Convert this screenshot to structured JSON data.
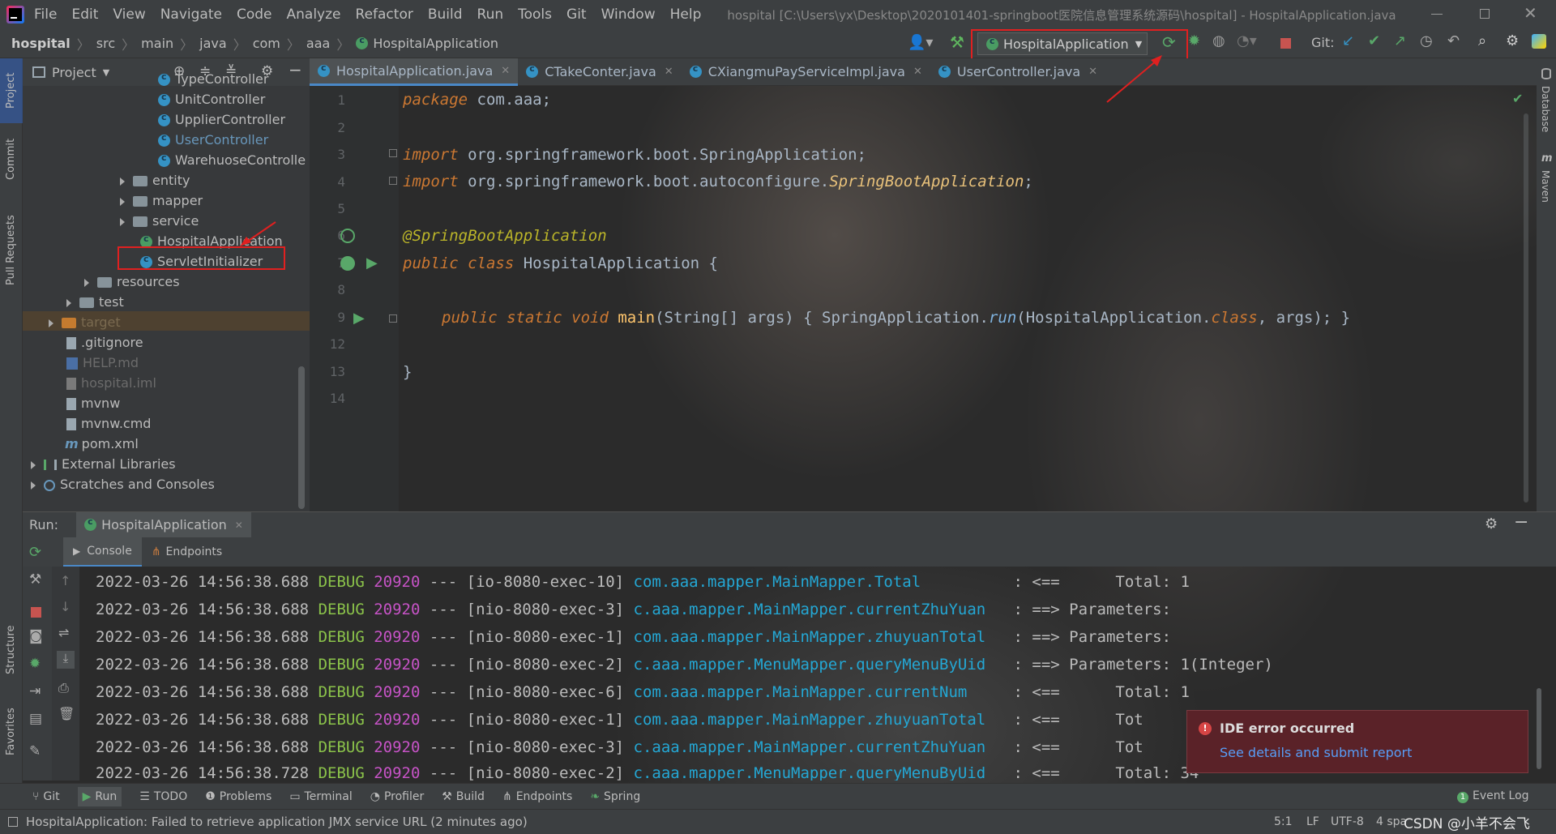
{
  "menubar": {
    "items": [
      "File",
      "Edit",
      "View",
      "Navigate",
      "Code",
      "Analyze",
      "Refactor",
      "Build",
      "Run",
      "Tools",
      "Git",
      "Window",
      "Help"
    ],
    "window_title": "hospital [C:\\Users\\yx\\Desktop\\2020101401-springboot医院信息管理系统源码\\hospital] - HospitalApplication.java"
  },
  "breadcrumb": [
    "hospital",
    "src",
    "main",
    "java",
    "com",
    "aaa",
    "HospitalApplication"
  ],
  "run_config": {
    "label": "HospitalApplication"
  },
  "git_label": "Git:",
  "tabs": [
    {
      "label": "HospitalApplication.java",
      "active": true
    },
    {
      "label": "CTakeConter.java",
      "active": false
    },
    {
      "label": "CXiangmuPayServiceImpl.java",
      "active": false
    },
    {
      "label": "UserController.java",
      "active": false
    }
  ],
  "project_panel": {
    "title": "Project",
    "tree": [
      {
        "label": "TypeController",
        "icon": "class-icon"
      },
      {
        "label": "UnitController",
        "icon": "class-icon"
      },
      {
        "label": "UpplierController",
        "icon": "class-icon"
      },
      {
        "label": "UserController",
        "icon": "class-icon"
      },
      {
        "label": "WarehuoseControlle",
        "icon": "class-icon"
      },
      {
        "label": "entity",
        "icon": "folder-icon"
      },
      {
        "label": "mapper",
        "icon": "folder-icon"
      },
      {
        "label": "service",
        "icon": "folder-icon"
      },
      {
        "label": "HospitalApplication",
        "icon": "spring-app-icon"
      },
      {
        "label": "ServletInitializer",
        "icon": "class-icon"
      },
      {
        "label": "resources",
        "icon": "folder-icon"
      },
      {
        "label": "test",
        "icon": "folder-icon"
      },
      {
        "label": "target",
        "icon": "folder-icon"
      },
      {
        "label": ".gitignore",
        "icon": "file-icon"
      },
      {
        "label": "HELP.md",
        "icon": "md-icon"
      },
      {
        "label": "hospital.iml",
        "icon": "file-icon"
      },
      {
        "label": "mvnw",
        "icon": "file-icon"
      },
      {
        "label": "mvnw.cmd",
        "icon": "file-icon"
      },
      {
        "label": "pom.xml",
        "icon": "maven-icon"
      },
      {
        "label": "External Libraries",
        "icon": "library-icon"
      },
      {
        "label": "Scratches and Consoles",
        "icon": "scratch-icon"
      }
    ]
  },
  "left_strip": {
    "project": "Project",
    "commit": "Commit",
    "pull_requests": "Pull Requests",
    "structure": "Structure",
    "favorites": "Favorites"
  },
  "right_strip": {
    "database": "Database",
    "maven": "Maven"
  },
  "editor": {
    "line_numbers": [
      "1",
      "2",
      "3",
      "4",
      "5",
      "6",
      "7",
      "8",
      "9",
      "12",
      "13",
      "14"
    ],
    "code": {
      "l1_kw": "package",
      "l1_rest": " com.aaa;",
      "l3_kw": "import",
      "l3_rest": " org.springframework.boot.SpringApplication;",
      "l4_kw": "import",
      "l4_rest": " org.springframework.boot.autoconfigure.",
      "l4_it": "SpringBootApplication",
      "l4_end": ";",
      "l6_an": "@SpringBootApplication",
      "l7_kw1": "public",
      "l7_kw2": "class",
      "l7_rest": " HospitalApplication {",
      "l9_kw": "public static void",
      "l9_fn": " main",
      "l9_p1": "(String[] ",
      "l9_args": "args",
      "l9_p2": ") { SpringApplication.",
      "l9_run": "run",
      "l9_p3": "(HospitalApplication.",
      "l9_class": "class",
      "l9_p4": ", ",
      "l9_args2": "args",
      "l9_p5": "); }",
      "l13": "}"
    }
  },
  "run_panel": {
    "label": "Run:",
    "tab": "HospitalApplication",
    "subtabs": [
      "Console",
      "Endpoints"
    ]
  },
  "console": [
    {
      "ts": "2022-03-26 14:56:38.688",
      "level": "DEBUG",
      "pid": "20920",
      "thread": "--- [io-8080-exec-10]",
      "logger": "com.aaa.mapper.MainMapper.Total         ",
      "msg": " : <==      Total: 1"
    },
    {
      "ts": "2022-03-26 14:56:38.688",
      "level": "DEBUG",
      "pid": "20920",
      "thread": "--- [nio-8080-exec-3]",
      "logger": "c.aaa.mapper.MainMapper.currentZhuYuan  ",
      "msg": " : ==> Parameters: "
    },
    {
      "ts": "2022-03-26 14:56:38.688",
      "level": "DEBUG",
      "pid": "20920",
      "thread": "--- [nio-8080-exec-1]",
      "logger": "com.aaa.mapper.MainMapper.zhuyuanTotal  ",
      "msg": " : ==> Parameters: "
    },
    {
      "ts": "2022-03-26 14:56:38.688",
      "level": "DEBUG",
      "pid": "20920",
      "thread": "--- [nio-8080-exec-2]",
      "logger": "c.aaa.mapper.MenuMapper.queryMenuByUid  ",
      "msg": " : ==> Parameters: 1(Integer)"
    },
    {
      "ts": "2022-03-26 14:56:38.688",
      "level": "DEBUG",
      "pid": "20920",
      "thread": "--- [nio-8080-exec-6]",
      "logger": "com.aaa.mapper.MainMapper.currentNum    ",
      "msg": " : <==      Total: 1"
    },
    {
      "ts": "2022-03-26 14:56:38.688",
      "level": "DEBUG",
      "pid": "20920",
      "thread": "--- [nio-8080-exec-1]",
      "logger": "com.aaa.mapper.MainMapper.zhuyuanTotal  ",
      "msg": " : <==      Tot"
    },
    {
      "ts": "2022-03-26 14:56:38.688",
      "level": "DEBUG",
      "pid": "20920",
      "thread": "--- [nio-8080-exec-3]",
      "logger": "c.aaa.mapper.MainMapper.currentZhuYuan  ",
      "msg": " : <==      Tot"
    },
    {
      "ts": "2022-03-26 14:56:38.728",
      "level": "DEBUG",
      "pid": "20920",
      "thread": "--- [nio-8080-exec-2]",
      "logger": "c.aaa.mapper.MenuMapper.queryMenuByUid  ",
      "msg": " : <==      Total: 34"
    }
  ],
  "notification": {
    "title": "IDE error occurred",
    "link": "See details and submit report"
  },
  "tool_windows": [
    "Git",
    "Run",
    "TODO",
    "Problems",
    "Terminal",
    "Profiler",
    "Build",
    "Endpoints",
    "Spring"
  ],
  "event_log": "Event Log",
  "status": {
    "message": "HospitalApplication: Failed to retrieve application JMX service URL (2 minutes ago)",
    "position": "5:1",
    "line_sep": "LF",
    "encoding": "UTF-8",
    "indent": "4 spa",
    "watermark": "CSDN @小羊不会飞"
  },
  "colors": {
    "accent_red": "#e02020",
    "keyword": "#cc7832",
    "annotation": "#bbb529",
    "debug": "#8bc34a",
    "pid": "#c653c6",
    "logger": "#24a7d4"
  }
}
